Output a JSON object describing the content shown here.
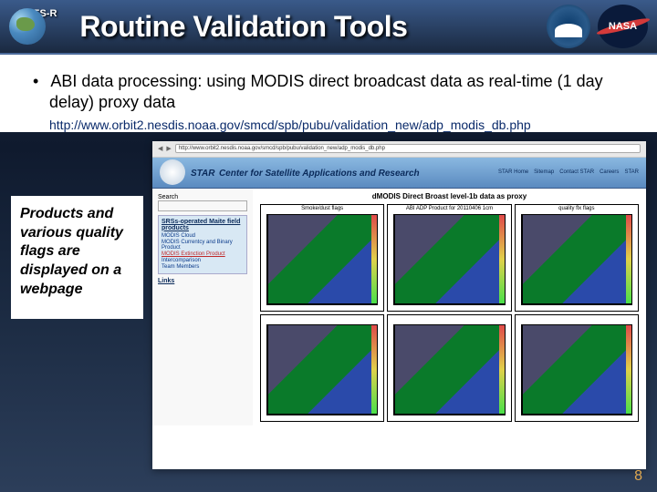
{
  "header": {
    "goes_label": "GOES-R",
    "title": "Routine Validation Tools",
    "nasa_label": "NASA"
  },
  "bullet": {
    "text": "ABI data processing: using MODIS direct broadcast data as real-time (1 day delay) proxy data"
  },
  "url": "http://www.orbit2.nesdis.noaa.gov/smcd/spb/pubu/validation_new/adp_modis_db.php",
  "callout": "Products and various quality flags are displayed on a webpage",
  "browser": {
    "address": "http://www.orbit2.nesdis.noaa.gov/smcd/spb/pubu/validation_new/adp_modis_db.php",
    "star": {
      "title": "STAR",
      "subtitle": "Center for Satellite Applications and Research"
    },
    "nav": [
      "STAR Home",
      "Sitemap",
      "Contact STAR",
      "Careers",
      "STAR"
    ],
    "search_label": "Search",
    "sidebar": {
      "heading": "SRSs-operated Maite field products",
      "links": [
        "MODIS Cloud",
        "MODIS Currentcy and Binary Product",
        "MODIS Extinction Product",
        "Intercomparison",
        "Team Members"
      ],
      "links_sec": "Links"
    },
    "panel_title": "dMODIS Direct Broast level-1b data as proxy",
    "map_labels": [
      "Smoke/dust flags",
      "ABI ADP Product for 20110406 1cm",
      "quality flx flags"
    ]
  },
  "slide_number": "8"
}
